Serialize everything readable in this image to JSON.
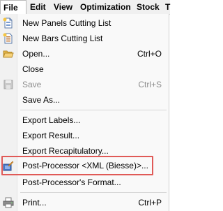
{
  "menubar": {
    "items": [
      {
        "label": "File"
      },
      {
        "label": "Edit"
      },
      {
        "label": "View"
      },
      {
        "label": "Optimization"
      },
      {
        "label": "Stock"
      },
      {
        "label": "T"
      }
    ]
  },
  "file_menu": {
    "items": [
      {
        "label": "New Panels Cutting List",
        "shortcut": "",
        "icon": "new-panels-icon",
        "enabled": true
      },
      {
        "label": "New Bars Cutting List",
        "shortcut": "",
        "icon": "new-bars-icon",
        "enabled": true
      },
      {
        "label": "Open...",
        "shortcut": "Ctrl+O",
        "icon": "open-folder-icon",
        "enabled": true
      },
      {
        "label": "Close",
        "shortcut": "",
        "icon": "",
        "enabled": true
      },
      {
        "label": "Save",
        "shortcut": "Ctrl+S",
        "icon": "save-icon",
        "enabled": false
      },
      {
        "label": "Save As...",
        "shortcut": "",
        "icon": "",
        "enabled": true
      },
      {
        "label": "Export Labels...",
        "shortcut": "",
        "icon": "",
        "enabled": true
      },
      {
        "label": "Export Result...",
        "shortcut": "",
        "icon": "",
        "enabled": true
      },
      {
        "label": "Export Recapitulatory...",
        "shortcut": "",
        "icon": "",
        "enabled": true
      },
      {
        "label": "Post-Processor <XML (Biesse)>...",
        "shortcut": "",
        "icon": "post-processor-icon",
        "enabled": true
      },
      {
        "label": "Post-Processor's Format...",
        "shortcut": "",
        "icon": "",
        "enabled": true
      },
      {
        "label": "Print...",
        "shortcut": "Ctrl+P",
        "icon": "printer-icon",
        "enabled": true
      }
    ]
  },
  "colors": {
    "highlight_border": "#e05a57",
    "disabled_text": "#8d8d8d"
  }
}
